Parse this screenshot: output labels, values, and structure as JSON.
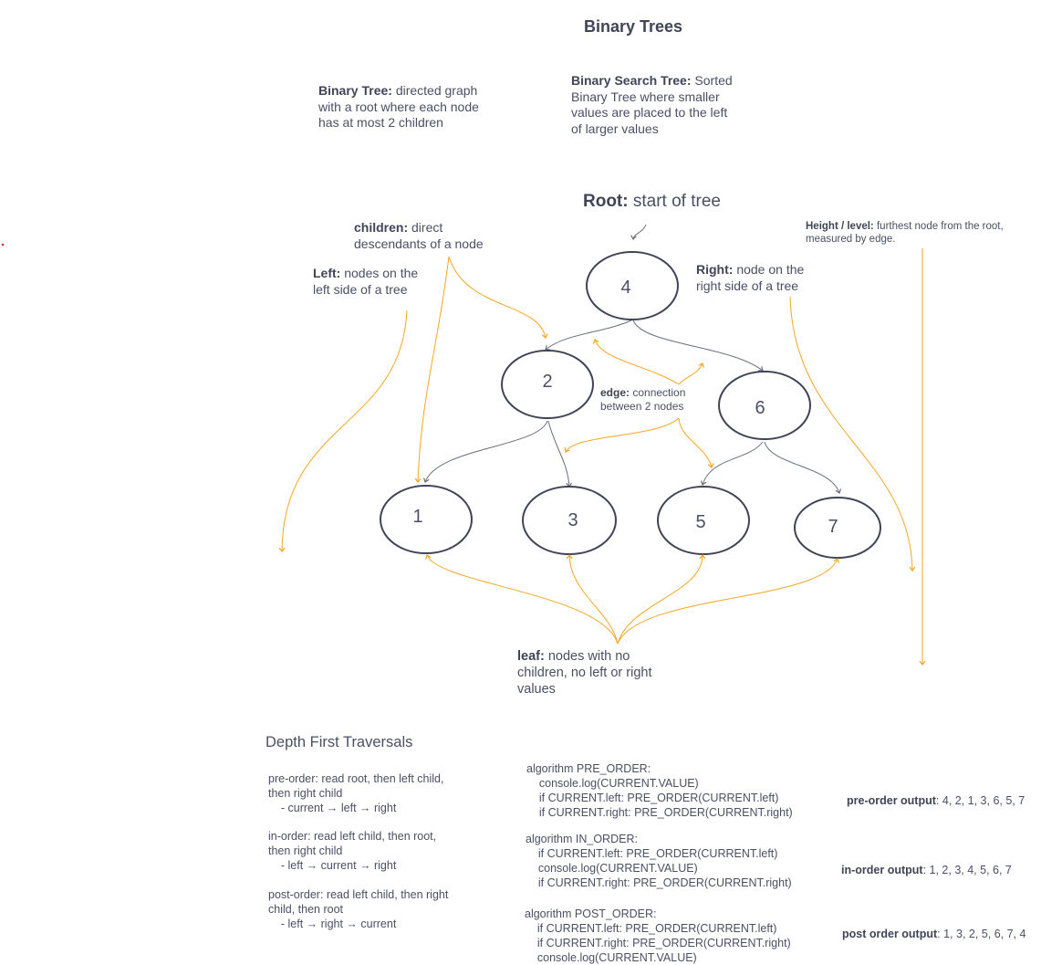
{
  "title": "Binary Trees",
  "definitions": {
    "binary_tree": {
      "term": "Binary Tree:",
      "lines": [
        " directed graph",
        "with a root where each node",
        "has at most 2 children"
      ]
    },
    "bst": {
      "term": "Binary Search Tree:",
      "lines": [
        " Sorted",
        "Binary Tree where smaller",
        "values are placed to the left",
        "of larger values"
      ]
    }
  },
  "annotations": {
    "root": {
      "term": "Root:",
      "text": " start of tree"
    },
    "children": {
      "term": "children:",
      "lines": [
        " direct",
        "descendants of a node"
      ]
    },
    "left": {
      "term": "Left:",
      "lines": [
        " nodes on the",
        "left side of a tree"
      ]
    },
    "right": {
      "term": "Right:",
      "lines": [
        " node on the",
        "right side of a tree"
      ]
    },
    "height": {
      "term": "Height / level:",
      "lines": [
        " furthest node from the root,",
        "measured by edge."
      ]
    },
    "edge": {
      "term": "edge:",
      "lines": [
        " connection",
        "between 2 nodes"
      ]
    },
    "leaf": {
      "term": "leaf:",
      "lines": [
        "  nodes with no",
        "children, no left or right",
        "values"
      ]
    }
  },
  "tree": {
    "nodes": [
      "4",
      "2",
      "6",
      "1",
      "3",
      "5",
      "7"
    ]
  },
  "traversals": {
    "heading": "Depth First Traversals",
    "pre": {
      "lines": [
        "pre-order: read root, then left child,",
        "then right child",
        "    - current → left → right"
      ]
    },
    "in": {
      "lines": [
        "in-order: read left child, then root,",
        "then right child",
        "    - left → current → right"
      ]
    },
    "post": {
      "lines": [
        "post-order: read left child, then right",
        "child, then root",
        "    - left → right → current"
      ]
    }
  },
  "algorithms": {
    "pre": [
      "algorithm PRE_ORDER:",
      "    console.log(CURRENT.VALUE)",
      "    if CURRENT.left: PRE_ORDER(CURRENT.left)",
      "    if CURRENT.right: PRE_ORDER(CURRENT.right)"
    ],
    "in": [
      "algorithm IN_ORDER:",
      "    if CURRENT.left: PRE_ORDER(CURRENT.left)",
      "    console.log(CURRENT.VALUE)",
      "    if CURRENT.right: PRE_ORDER(CURRENT.right)"
    ],
    "post": [
      "algorithm POST_ORDER:",
      "    if CURRENT.left: PRE_ORDER(CURRENT.left)",
      "    if CURRENT.right: PRE_ORDER(CURRENT.right)",
      "    console.log(CURRENT.VALUE)"
    ]
  },
  "outputs": {
    "pre": {
      "label": "pre-order output",
      "value": ": 4, 2, 1, 3, 6, 5, 7"
    },
    "in": {
      "label": "in-order output",
      "value": ": 1, 2, 3, 4, 5, 6, 7"
    },
    "post": {
      "label": "post order output",
      "value": ": 1, 3, 2, 5, 6, 7, 4"
    }
  },
  "colors": {
    "annotation_arrow": "#f5a623",
    "edge": "#6b7080",
    "node_stroke": "#3f4556",
    "text": "#4a5064"
  }
}
